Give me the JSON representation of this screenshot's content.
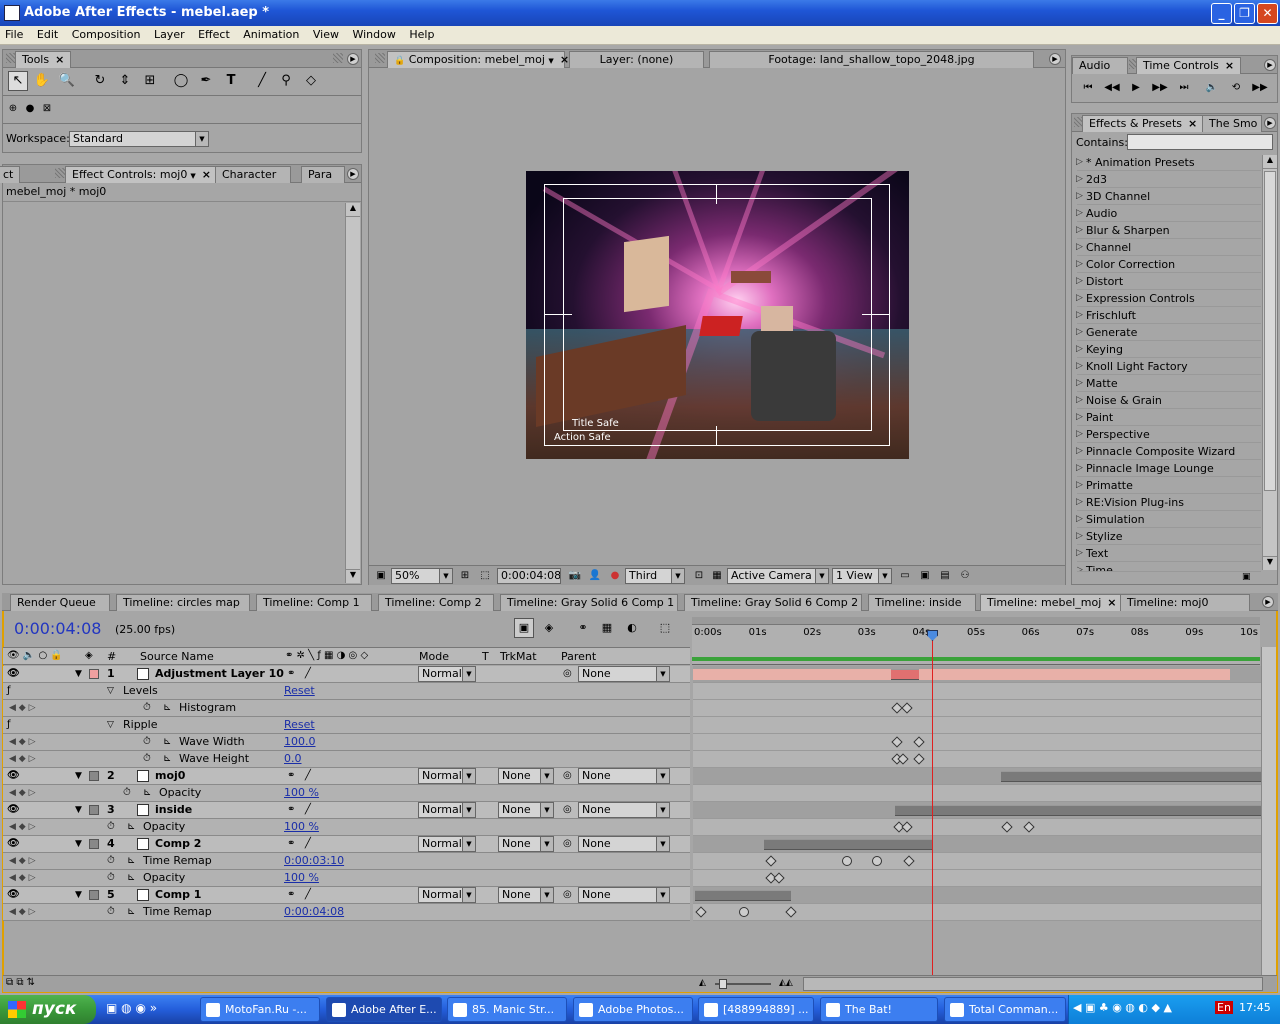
{
  "window": {
    "title": "Adobe After Effects - mebel.aep *"
  },
  "menu": [
    "File",
    "Edit",
    "Composition",
    "Layer",
    "Effect",
    "Animation",
    "View",
    "Window",
    "Help"
  ],
  "tools": {
    "tab": "Tools",
    "workspace_label": "Workspace:",
    "workspace_value": "Standard"
  },
  "effect_controls": {
    "tabs": [
      "ct",
      "Effect Controls: moj0",
      "Character",
      "Para"
    ],
    "breadcrumb": "mebel_moj * moj0"
  },
  "viewer": {
    "tabs": [
      "Composition: mebel_moj",
      "Layer: (none)",
      "Footage: land_shallow_topo_2048.jpg"
    ],
    "title_safe": "Title Safe",
    "action_safe": "Action Safe",
    "zoom": "50%",
    "timecode": "0:00:04:08",
    "resolution": "Third",
    "camera": "Active Camera",
    "views": "1 View"
  },
  "time_controls": {
    "tabs": [
      "Audio",
      "Time Controls"
    ]
  },
  "effects_presets": {
    "tabs": [
      "Effects & Presets",
      "The Smo"
    ],
    "contains_label": "Contains:",
    "items": [
      "* Animation Presets",
      "2d3",
      "3D Channel",
      "Audio",
      "Blur & Sharpen",
      "Channel",
      "Color Correction",
      "Distort",
      "Expression Controls",
      "Frischluft",
      "Generate",
      "Keying",
      "Knoll Light Factory",
      "Matte",
      "Noise & Grain",
      "Paint",
      "Perspective",
      "Pinnacle Composite Wizard",
      "Pinnacle Image Lounge",
      "Primatte",
      "RE:Vision Plug-ins",
      "Simulation",
      "Stylize",
      "Text",
      "Time"
    ]
  },
  "timeline": {
    "tabs": [
      "Render Queue",
      "Timeline: circles map",
      "Timeline: Comp 1",
      "Timeline: Comp 2",
      "Timeline: Gray Solid 6 Comp 1",
      "Timeline: Gray Solid 6 Comp 2",
      "Timeline: inside",
      "Timeline: mebel_moj",
      "Timeline: moj0"
    ],
    "timecode": "0:00:04:08",
    "fps": "(25.00 fps)",
    "headers": {
      "num": "#",
      "source": "Source Name",
      "mode": "Mode",
      "t": "T",
      "trkmat": "TrkMat",
      "parent": "Parent"
    },
    "ruler": [
      "0:00s",
      "01s",
      "02s",
      "03s",
      "04s",
      "05s",
      "06s",
      "07s",
      "08s",
      "09s",
      "10s"
    ],
    "rows": [
      {
        "type": "layer",
        "num": "1",
        "name": "Adjustment Layer 10",
        "mode": "Normal",
        "trkmat": "",
        "parent": "None",
        "color": "#f0a0a0"
      },
      {
        "type": "effect",
        "name": "Levels",
        "value": "Reset"
      },
      {
        "type": "prop",
        "name": "Histogram",
        "value": ""
      },
      {
        "type": "effect",
        "name": "Ripple",
        "value": "Reset"
      },
      {
        "type": "prop",
        "name": "Wave Width",
        "value": "100.0"
      },
      {
        "type": "prop",
        "name": "Wave Height",
        "value": "0.0"
      },
      {
        "type": "layer",
        "num": "2",
        "name": "moj0",
        "mode": "Normal",
        "trkmat": "None",
        "parent": "None",
        "color": "#888888"
      },
      {
        "type": "prop",
        "name": "Opacity",
        "value": "100 %"
      },
      {
        "type": "layer",
        "num": "3",
        "name": "inside",
        "mode": "Normal",
        "trkmat": "None",
        "parent": "None",
        "color": "#888888"
      },
      {
        "type": "prop",
        "name": "Opacity",
        "value": "100 %"
      },
      {
        "type": "layer",
        "num": "4",
        "name": "Comp 2",
        "mode": "Normal",
        "trkmat": "None",
        "parent": "None",
        "color": "#888888"
      },
      {
        "type": "prop",
        "name": "Time Remap",
        "value": "0:00:03:10"
      },
      {
        "type": "prop",
        "name": "Opacity",
        "value": "100 %"
      },
      {
        "type": "layer",
        "num": "5",
        "name": "Comp 1",
        "mode": "Normal",
        "trkmat": "None",
        "parent": "None",
        "color": "#888888"
      },
      {
        "type": "prop",
        "name": "Time Remap",
        "value": "0:00:04:08"
      }
    ]
  },
  "taskbar": {
    "start": "пуск",
    "items": [
      "MotoFan.Ru -...",
      "Adobe After E...",
      "85. Manic Str...",
      "Adobe Photos...",
      "[488994889] ...",
      "The Bat!",
      "Total Comman..."
    ],
    "lang": "En",
    "clock": "17:45"
  }
}
